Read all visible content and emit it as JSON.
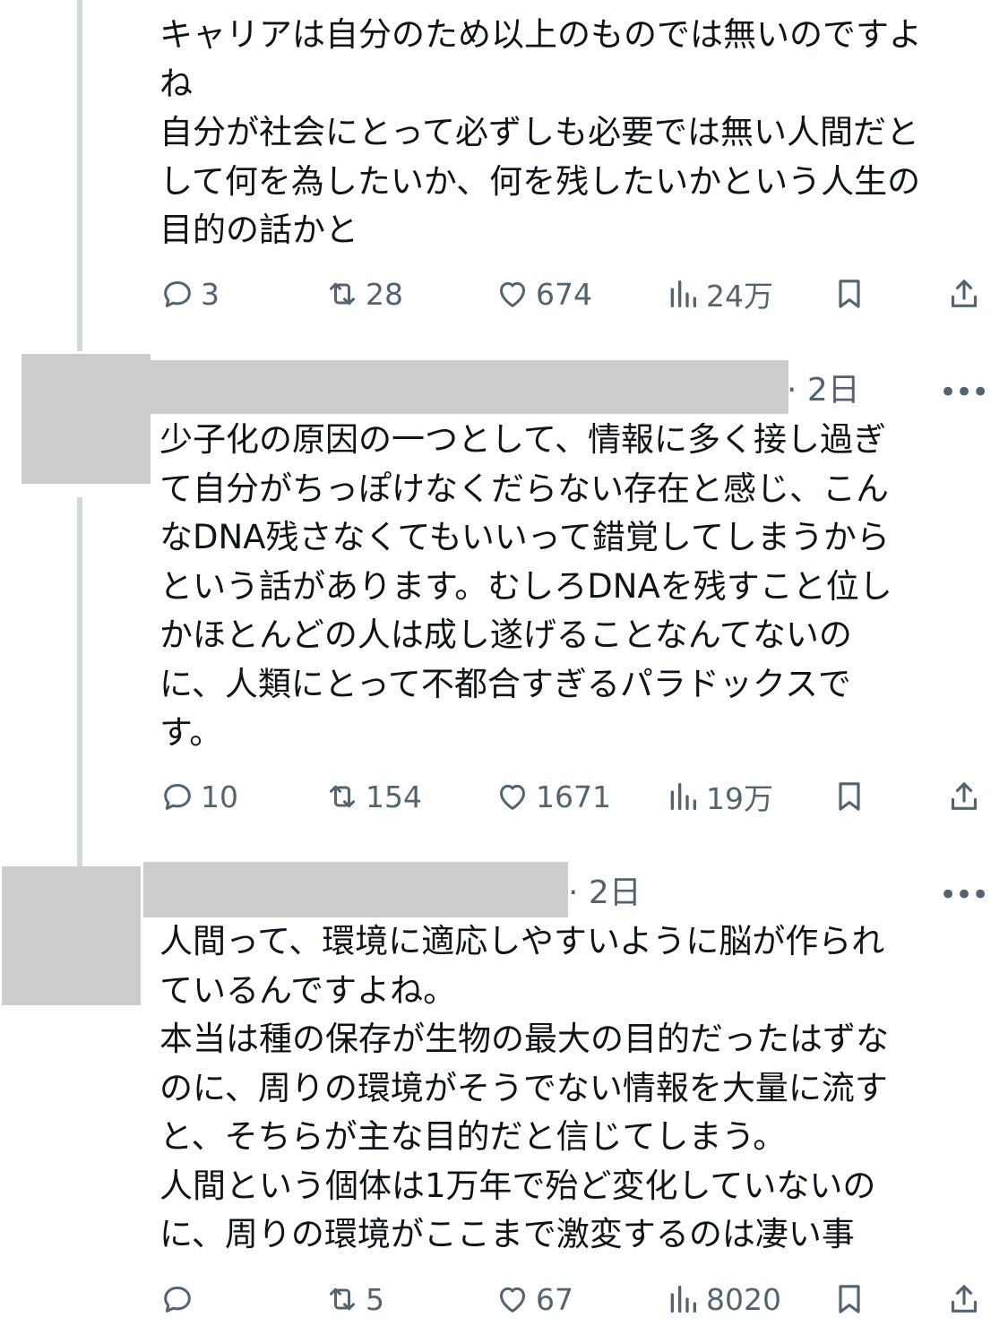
{
  "posts": [
    {
      "time": "",
      "text": "キャリアは自分のため以上のものでは無いのですよ\nね\n自分が社会にとって必ずしも必要では無い人間だと\nして何を為したいか、何を残したいかという人生の\n目的の話かと",
      "replies": "3",
      "reposts": "28",
      "likes": "674",
      "views": "24万"
    },
    {
      "time": "· 2日",
      "text": "少子化の原因の一つとして、情報に多く接し過ぎ\nて自分がちっぽけなくだらない存在と感じ、こん\nなDNA残さなくてもいいって錯覚してしまうから\nという話があります。むしろDNAを残すこと位し\nかほとんどの人は成し遂げることなんてないの\nに、人類にとって不都合すぎるパラドックスで\nす。",
      "replies": "10",
      "reposts": "154",
      "likes": "1671",
      "views": "19万"
    },
    {
      "time": "· 2日",
      "text": "人間って、環境に適応しやすいように脳が作られ\nているんですよね。\n本当は種の保存が生物の最大の目的だったはずな\nのに、周りの環境がそうでない情報を大量に流す\nと、そちらが主な目的だと信じてしまう。\n人間という個体は1万年で殆ど変化していないの\nに、周りの環境がここまで激変するのは凄い事",
      "replies": "",
      "reposts": "5",
      "likes": "67",
      "views": "8020"
    }
  ],
  "icons": {
    "reply": "reply-icon",
    "repost": "repost-icon",
    "like": "heart-icon",
    "views": "views-icon",
    "bookmark": "bookmark-icon",
    "share": "share-icon",
    "more": "more-icon"
  },
  "colors": {
    "text": "#0f1419",
    "secondary": "#536471",
    "thread_line": "#cfd9de",
    "redaction": "#cccccc"
  }
}
